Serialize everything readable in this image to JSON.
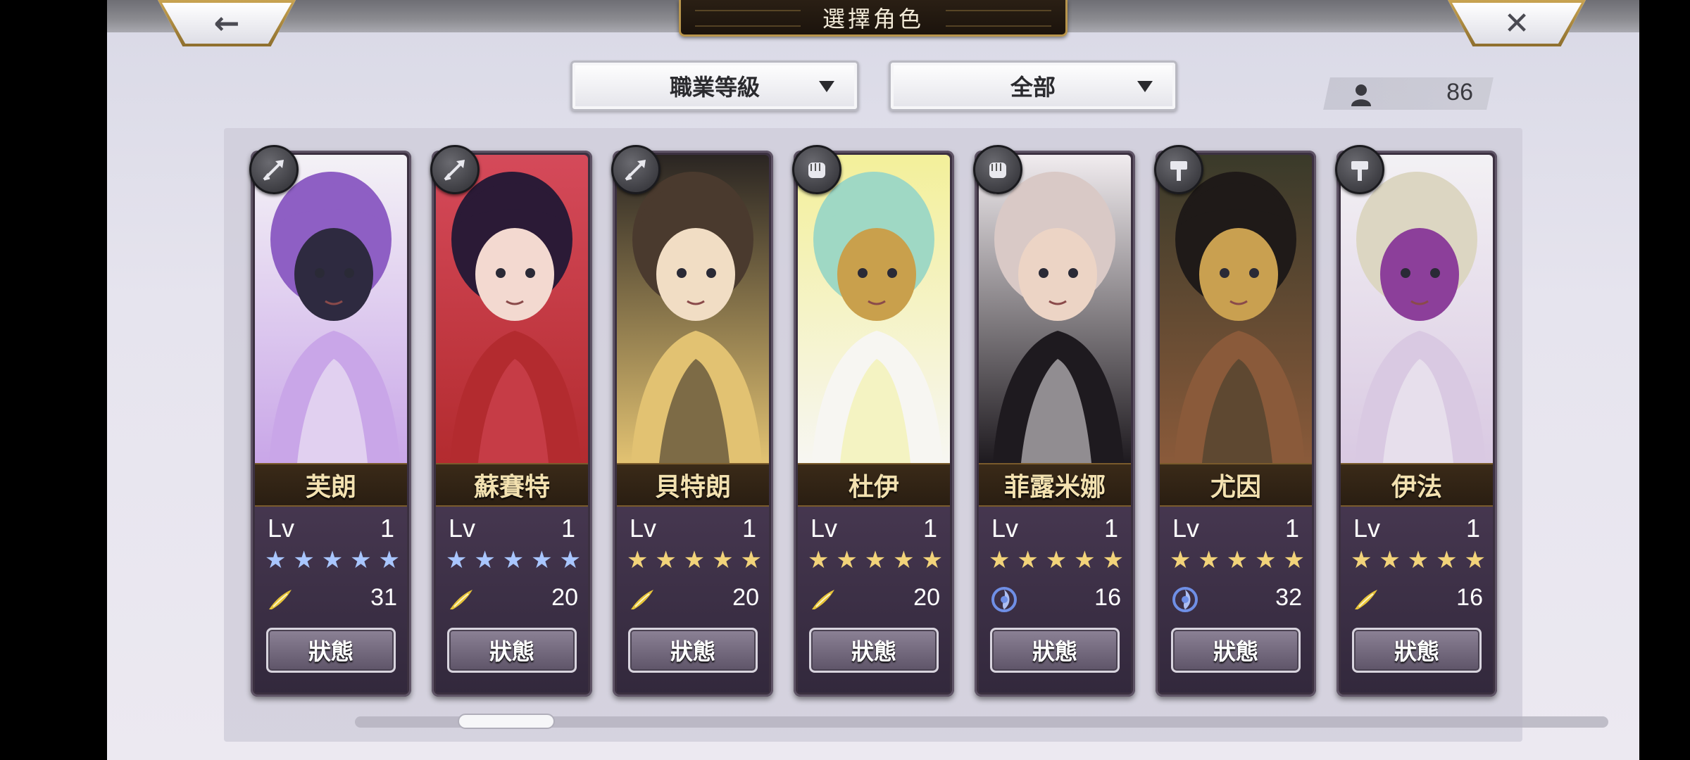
{
  "header": {
    "title": "選擇角色",
    "back_icon": "←",
    "close_icon": "✕"
  },
  "filters": {
    "class_dropdown": "職業等級",
    "scope_dropdown": "全部"
  },
  "party_count": "86",
  "status_label": "狀態",
  "colors": {
    "gold": "#c8a351",
    "blue_star": "#a9c6ff",
    "gold_star": "#f2d37a",
    "wind_element": "#e8c53a",
    "water_element": "#6f8fe6"
  },
  "characters": [
    {
      "name": "芙朗",
      "lv_label": "Lv",
      "lv": "1",
      "stars": 5,
      "star_color": "blue",
      "element": "wind-icon",
      "value": "31",
      "class_icon": "arrow-icon",
      "palette": [
        "#f4f2f6",
        "#8e5fc4",
        "#c9a6e8",
        "#2e2a40"
      ]
    },
    {
      "name": "蘇賽特",
      "lv_label": "Lv",
      "lv": "1",
      "stars": 5,
      "star_color": "blue",
      "element": "wind-icon",
      "value": "20",
      "class_icon": "arrow-icon",
      "palette": [
        "#d54a5a",
        "#2b1a36",
        "#b32b2f",
        "#f3d9d0"
      ]
    },
    {
      "name": "貝特朗",
      "lv_label": "Lv",
      "lv": "1",
      "stars": 5,
      "star_color": "gold",
      "element": "wind-icon",
      "value": "20",
      "class_icon": "arrow-icon",
      "palette": [
        "#2a2522",
        "#4a3a2e",
        "#e2c272",
        "#f1ddc4"
      ]
    },
    {
      "name": "杜伊",
      "lv_label": "Lv",
      "lv": "1",
      "stars": 5,
      "star_color": "gold",
      "element": "wind-icon",
      "value": "20",
      "class_icon": "fist-icon",
      "palette": [
        "#f3f09a",
        "#9fd8c4",
        "#f7f6f2",
        "#c9a04c"
      ]
    },
    {
      "name": "菲露米娜",
      "lv_label": "Lv",
      "lv": "1",
      "stars": 5,
      "star_color": "gold",
      "element": "water-icon",
      "value": "16",
      "class_icon": "fist-icon",
      "palette": [
        "#f1ecef",
        "#d9c9c6",
        "#1e1a1f",
        "#ecd4c5"
      ]
    },
    {
      "name": "尤因",
      "lv_label": "Lv",
      "lv": "1",
      "stars": 5,
      "star_color": "gold",
      "element": "water-icon",
      "value": "32",
      "class_icon": "hammer-icon",
      "palette": [
        "#3a3a2a",
        "#1f1a18",
        "#8a5a3a",
        "#c9a050"
      ]
    },
    {
      "name": "伊法",
      "lv_label": "Lv",
      "lv": "1",
      "stars": 5,
      "star_color": "gold",
      "element": "wind-icon",
      "value": "16",
      "class_icon": "hammer-icon",
      "palette": [
        "#f3f1f4",
        "#dcd6c2",
        "#d9c9e2",
        "#8c3f9a"
      ]
    }
  ]
}
